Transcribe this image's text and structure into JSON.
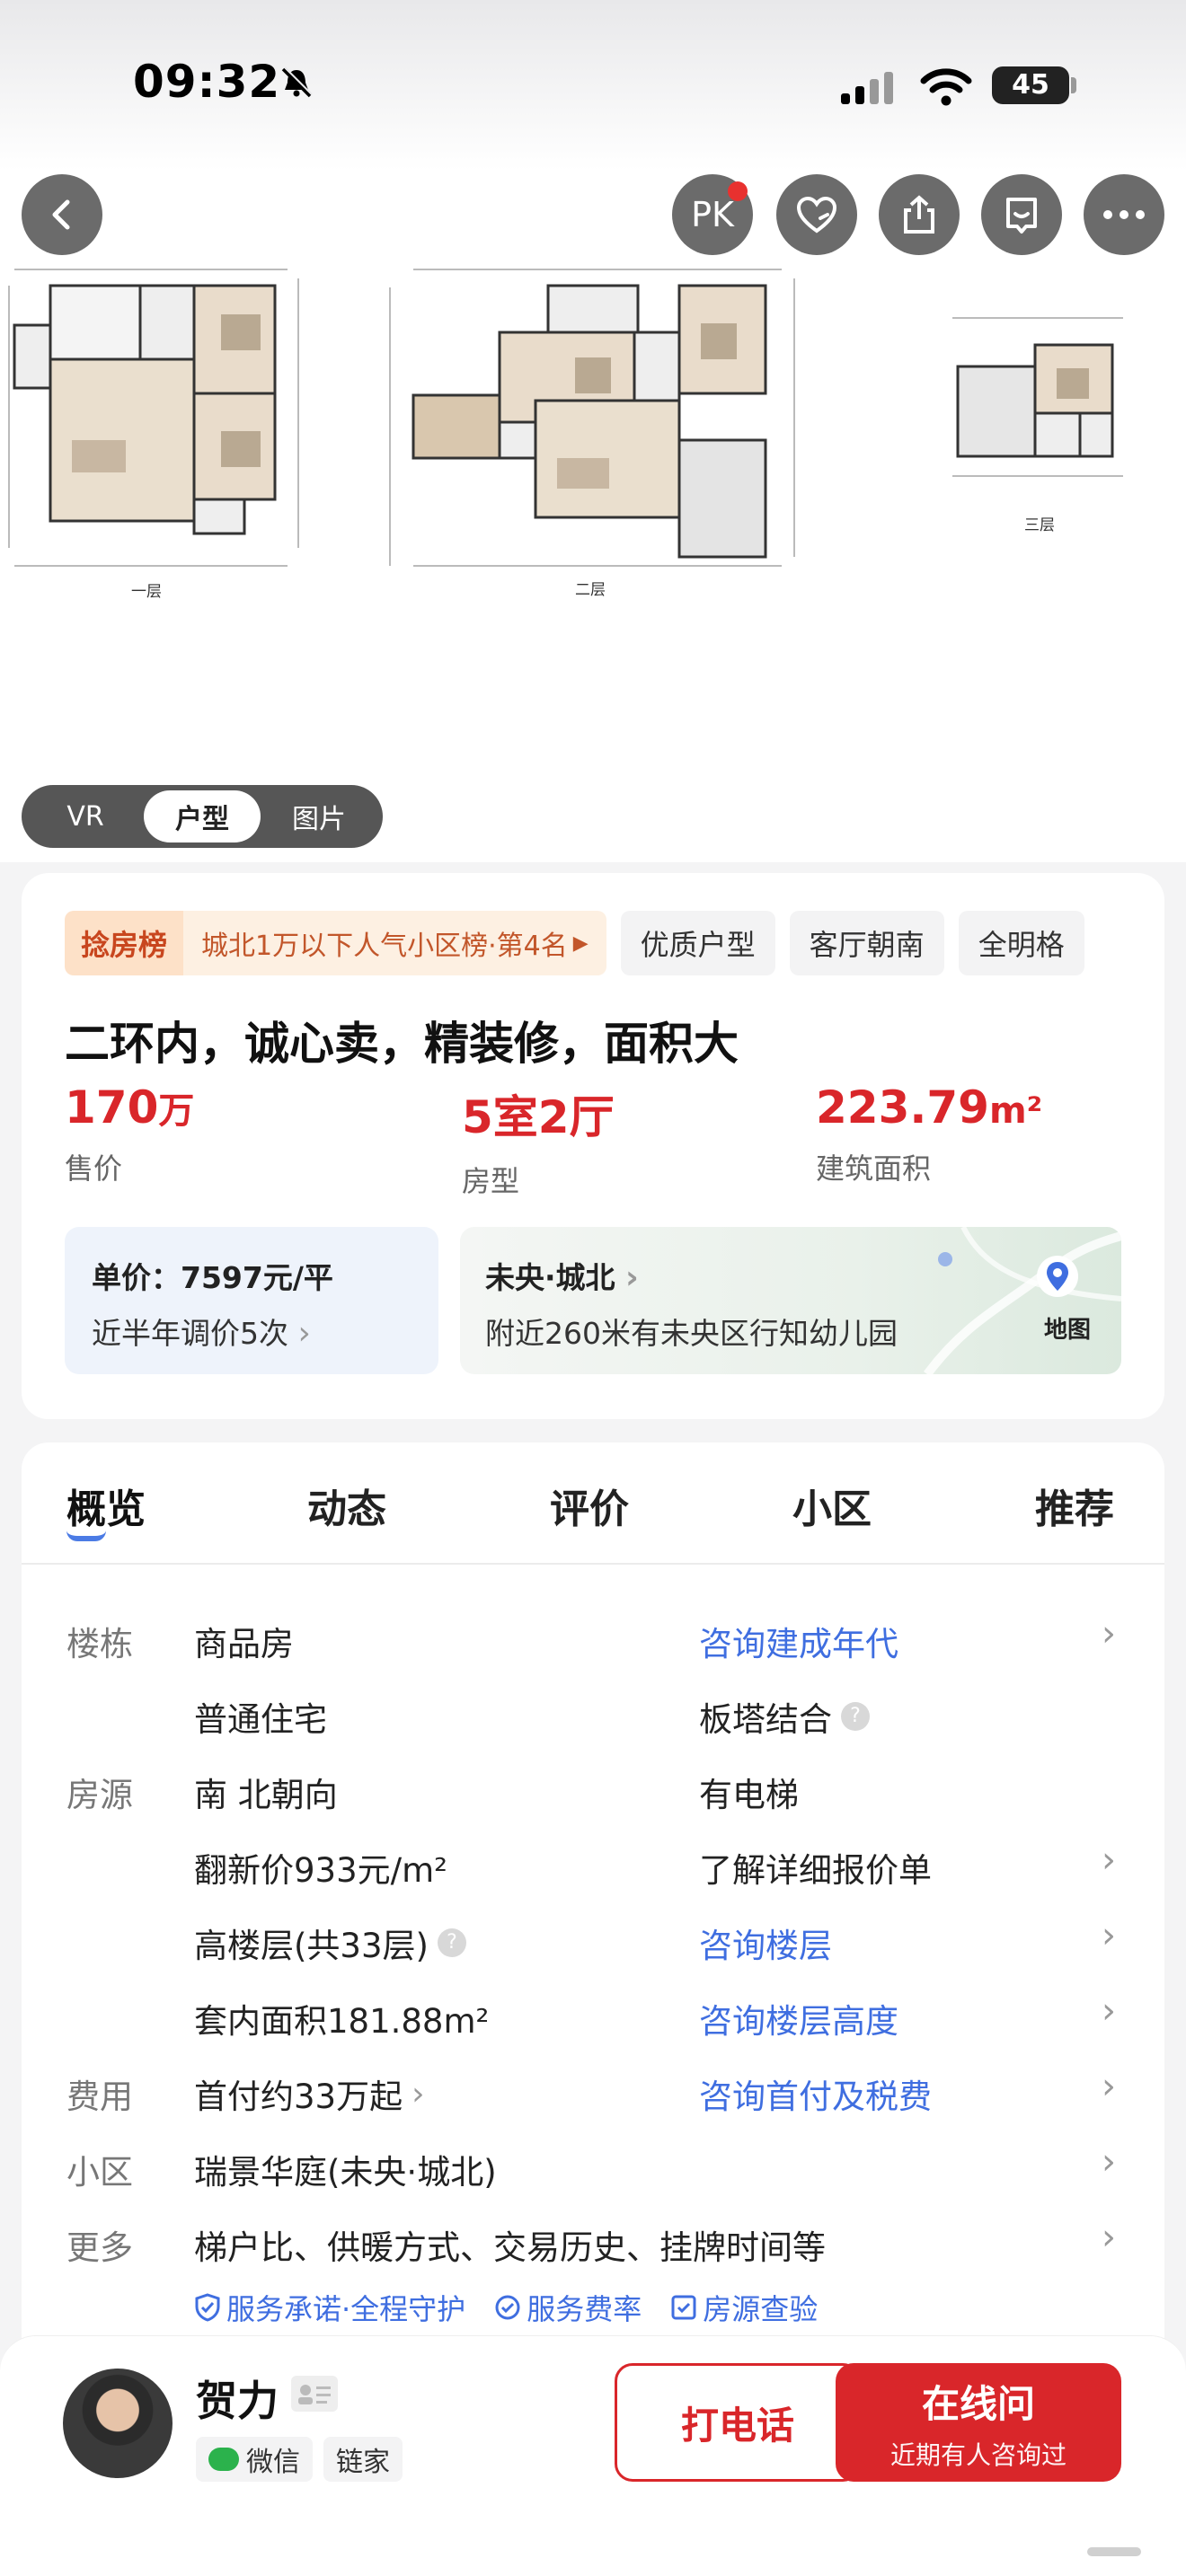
{
  "status_bar": {
    "time": "09:32",
    "battery": "45"
  },
  "header": {
    "pk_label": "PK"
  },
  "floor_plan": {
    "labels": [
      "一层",
      "二层",
      "三层"
    ]
  },
  "media_tabs": [
    "VR",
    "户型",
    "图片"
  ],
  "tags": {
    "rank_head": "捻房榜",
    "rank_body": "城北1万以下人气小区榜·第4名",
    "chips": [
      "优质户型",
      "客厅朝南",
      "全明格"
    ]
  },
  "title": "二环内，诚心卖，精装修，面积大",
  "stats": [
    {
      "value": "170",
      "unit": "万",
      "label": "售价"
    },
    {
      "value": "5室2厅",
      "unit": "",
      "label": "房型"
    },
    {
      "value": "223.79",
      "unit": "m²",
      "label": "建筑面积"
    }
  ],
  "unit_price": {
    "line1": "单价：7597元/平",
    "line2": "近半年调价5次"
  },
  "location": {
    "area": "未央·城北",
    "nearby": "附近260米有未央区行知幼儿园",
    "map_label": "地图"
  },
  "nav_tabs": [
    "概览",
    "动态",
    "评价",
    "小区",
    "推荐"
  ],
  "details": {
    "label_building": "楼栋",
    "label_source": "房源",
    "label_fee": "费用",
    "label_community": "小区",
    "label_more": "更多",
    "row1_left": "商品房",
    "row1_right": "咨询建成年代",
    "row2_left": "普通住宅",
    "row2_right": "板塔结合",
    "row3_left": "南 北朝向",
    "row3_right": "有电梯",
    "row4_left": "翻新价933元/m²",
    "row4_right": "了解详细报价单",
    "row5_left": "高楼层(共33层)",
    "row5_right": "咨询楼层",
    "row6_left": "套内面积181.88m²",
    "row6_right": "咨询楼层高度",
    "row7_left": "首付约33万起",
    "row7_right": "咨询首付及税费",
    "row8_left": "瑞景华庭(未央·城北)",
    "row9_left": "梯户比、供暖方式、交易历史、挂牌时间等"
  },
  "promises": [
    "服务承诺·全程守护",
    "服务费率",
    "房源查验"
  ],
  "agent": {
    "name": "贺力",
    "chip_wechat": "微信",
    "chip_company": "链家",
    "call_label": "打电话",
    "online_label": "在线问",
    "online_sub": "近期有人咨询过"
  },
  "colors": {
    "accent_red": "#d9262a",
    "link_blue": "#3f6ee0"
  }
}
